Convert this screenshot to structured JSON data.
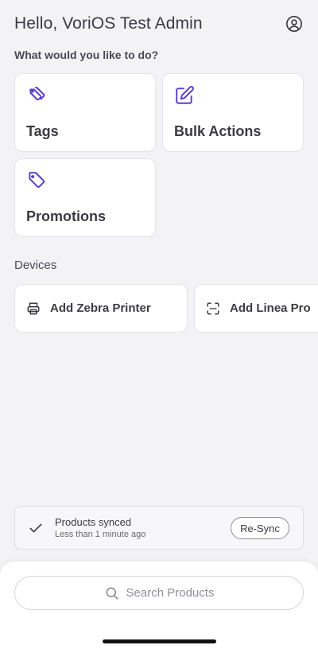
{
  "header": {
    "greeting": "Hello, VoriOS Test Admin",
    "account_icon": "user-circle-icon"
  },
  "actions": {
    "heading": "What would you like to do?",
    "items": [
      {
        "label": "Tags",
        "icon": "tags-icon"
      },
      {
        "label": "Bulk Actions",
        "icon": "edit-icon"
      },
      {
        "label": "Promotions",
        "icon": "tag-icon"
      }
    ]
  },
  "devices": {
    "heading": "Devices",
    "items": [
      {
        "label": "Add Zebra Printer",
        "icon": "printer-icon"
      },
      {
        "label": "Add Linea Pro",
        "icon": "scan-icon"
      }
    ]
  },
  "sync": {
    "title": "Products synced",
    "subtitle": "Less than 1 minute ago",
    "button": "Re-Sync"
  },
  "search": {
    "placeholder": "Search Products"
  },
  "colors": {
    "accent": "#5b3fc4",
    "background": "#f3f2f5",
    "text": "#3c3b44"
  }
}
